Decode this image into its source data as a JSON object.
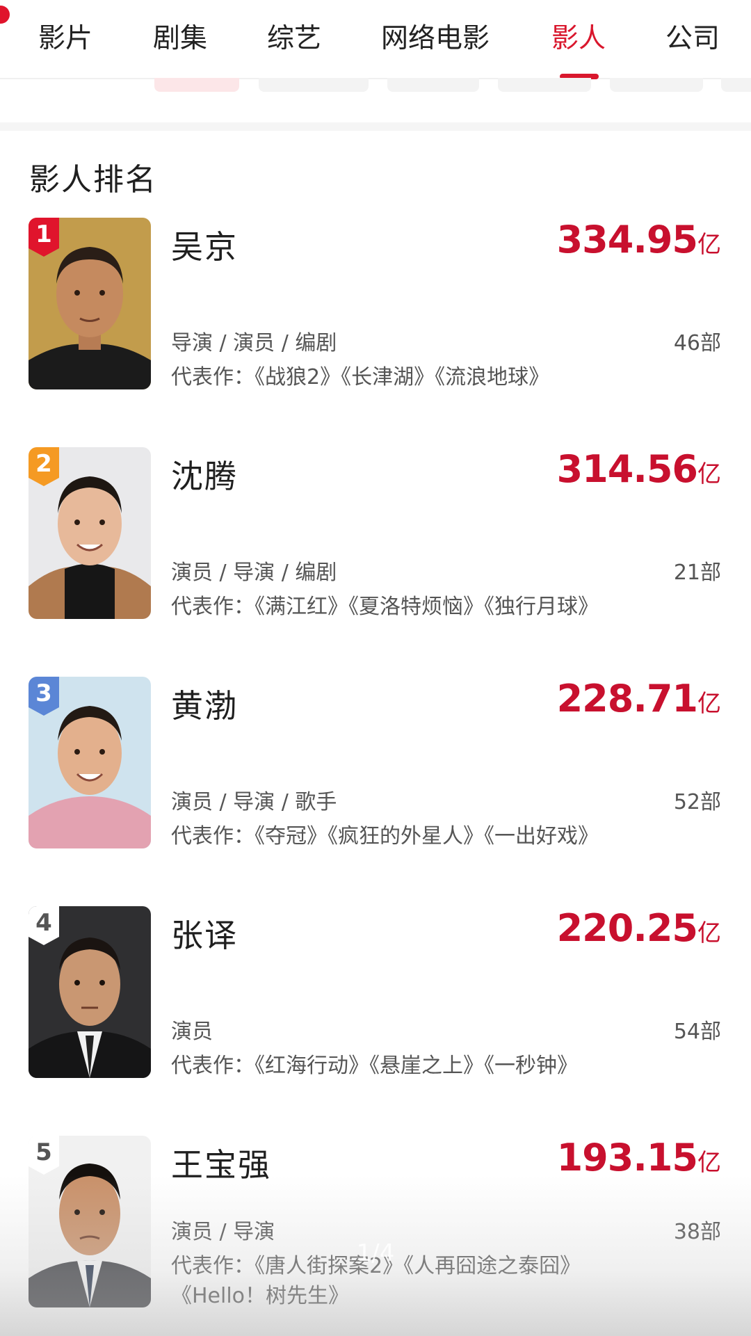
{
  "tabs": [
    {
      "label": "影片",
      "active": false
    },
    {
      "label": "剧集",
      "active": false
    },
    {
      "label": "综艺",
      "active": false
    },
    {
      "label": "网络电影",
      "active": false
    },
    {
      "label": "影人",
      "active": true
    },
    {
      "label": "公司",
      "active": false
    }
  ],
  "colors": {
    "accent": "#d9172d",
    "box_office": "#c8102e"
  },
  "section_title": "影人排名",
  "rankings": [
    {
      "rank": "1",
      "name": "吴京",
      "box_office": "334.95",
      "unit": "亿",
      "roles": "导演 / 演员 / 编剧",
      "count": "46部",
      "works": "代表作：《战狼2》《长津湖》《流浪地球》",
      "badge_color": "#e0142c"
    },
    {
      "rank": "2",
      "name": "沈腾",
      "box_office": "314.56",
      "unit": "亿",
      "roles": "演员 / 导演 / 编剧",
      "count": "21部",
      "works": "代表作：《满江红》《夏洛特烦恼》《独行月球》",
      "badge_color": "#f59a23"
    },
    {
      "rank": "3",
      "name": "黄渤",
      "box_office": "228.71",
      "unit": "亿",
      "roles": "演员 / 导演 / 歌手",
      "count": "52部",
      "works": "代表作：《夺冠》《疯狂的外星人》《一出好戏》",
      "badge_color": "#5b86d6"
    },
    {
      "rank": "4",
      "name": "张译",
      "box_office": "220.25",
      "unit": "亿",
      "roles": "演员",
      "count": "54部",
      "works": "代表作：《红海行动》《悬崖之上》《一秒钟》",
      "badge_color": "#ffffff"
    },
    {
      "rank": "5",
      "name": "王宝强",
      "box_office": "193.15",
      "unit": "亿",
      "roles": "演员 / 导演",
      "count": "38部",
      "works": "代表作：《唐人街探案2》《人再囧途之泰囧》《Hello！树先生》",
      "badge_color": "#ffffff"
    }
  ],
  "page_indicator": "1/4"
}
